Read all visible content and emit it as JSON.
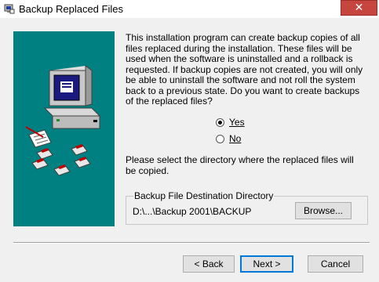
{
  "window": {
    "title": "Backup Replaced Files",
    "close_glyph": "✕"
  },
  "intro_text": "This installation program can create backup copies of all files replaced during the installation. These files will be used when the software is uninstalled and a rollback is requested.  If backup copies are not created, you will only be able to uninstall the software and not roll the system back to a previous state. Do you want to create backups of the replaced files?",
  "options": {
    "yes_label": "Yes",
    "no_label": "No",
    "selected": "Yes"
  },
  "directory_prompt": "Please select the directory where the replaced  files will be copied.",
  "destination": {
    "group_label": "Backup File Destination Directory",
    "path": "D:\\...\\Backup 2001\\BACKUP",
    "browse_label": "Browse..."
  },
  "buttons": {
    "back_label": "< Back",
    "next_label": "Next >",
    "cancel_label": "Cancel"
  },
  "colors": {
    "side_panel": "#008080",
    "close_button": "#c7453f"
  },
  "icons": [
    "installer-app-icon",
    "computer-illustration",
    "close-icon"
  ]
}
